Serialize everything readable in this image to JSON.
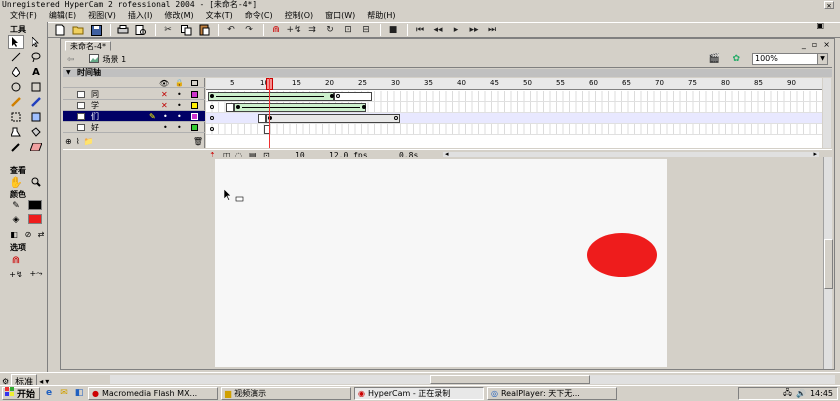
{
  "window": {
    "title": "Unregistered HyperCam 2  rofessional 2004 - [未命名-4*]",
    "close_glyph": "✕"
  },
  "menu": {
    "items": [
      "文件(F)",
      "编辑(E)",
      "视图(V)",
      "插入(I)",
      "修改(M)",
      "文本(T)",
      "命令(C)",
      "控制(O)",
      "窗口(W)",
      "帮助(H)"
    ],
    "restore_glyph": "▣"
  },
  "tools": {
    "section_tools": "工具",
    "section_view": "查看",
    "section_colors": "颜色",
    "section_options": "选项",
    "stroke_color": "#000000",
    "fill_color": "#ee1c1c"
  },
  "document": {
    "tab": "未命名-4*",
    "scene": "场景 1",
    "zoom": "100%"
  },
  "timeline": {
    "header": "时间轴",
    "ruler_ticks": [
      "5",
      "10",
      "15",
      "20",
      "25",
      "30",
      "35",
      "40",
      "45",
      "50",
      "55",
      "60",
      "65",
      "70",
      "75",
      "80",
      "85",
      "90"
    ],
    "current_frame": "10",
    "fps": "12.0 fps",
    "time": "0.8s",
    "layers": [
      {
        "name": "同",
        "color": "#cc33cc",
        "active": false
      },
      {
        "name": "学",
        "color": "#ffee00",
        "active": false
      },
      {
        "name": "们",
        "color": "#cc33cc",
        "active": true
      },
      {
        "name": "好",
        "color": "#33cc33",
        "active": false
      }
    ]
  },
  "stage": {
    "circle_color": "#ee1c1c",
    "background": "#f7f7f7"
  },
  "properties": {
    "label": "标准"
  },
  "taskbar": {
    "start": "开始",
    "tasks": [
      "Macromedia Flash MX...",
      "视频演示",
      "HyperCam - 正在录制",
      "RealPlayer: 天下无..."
    ],
    "clock": "14:45"
  }
}
